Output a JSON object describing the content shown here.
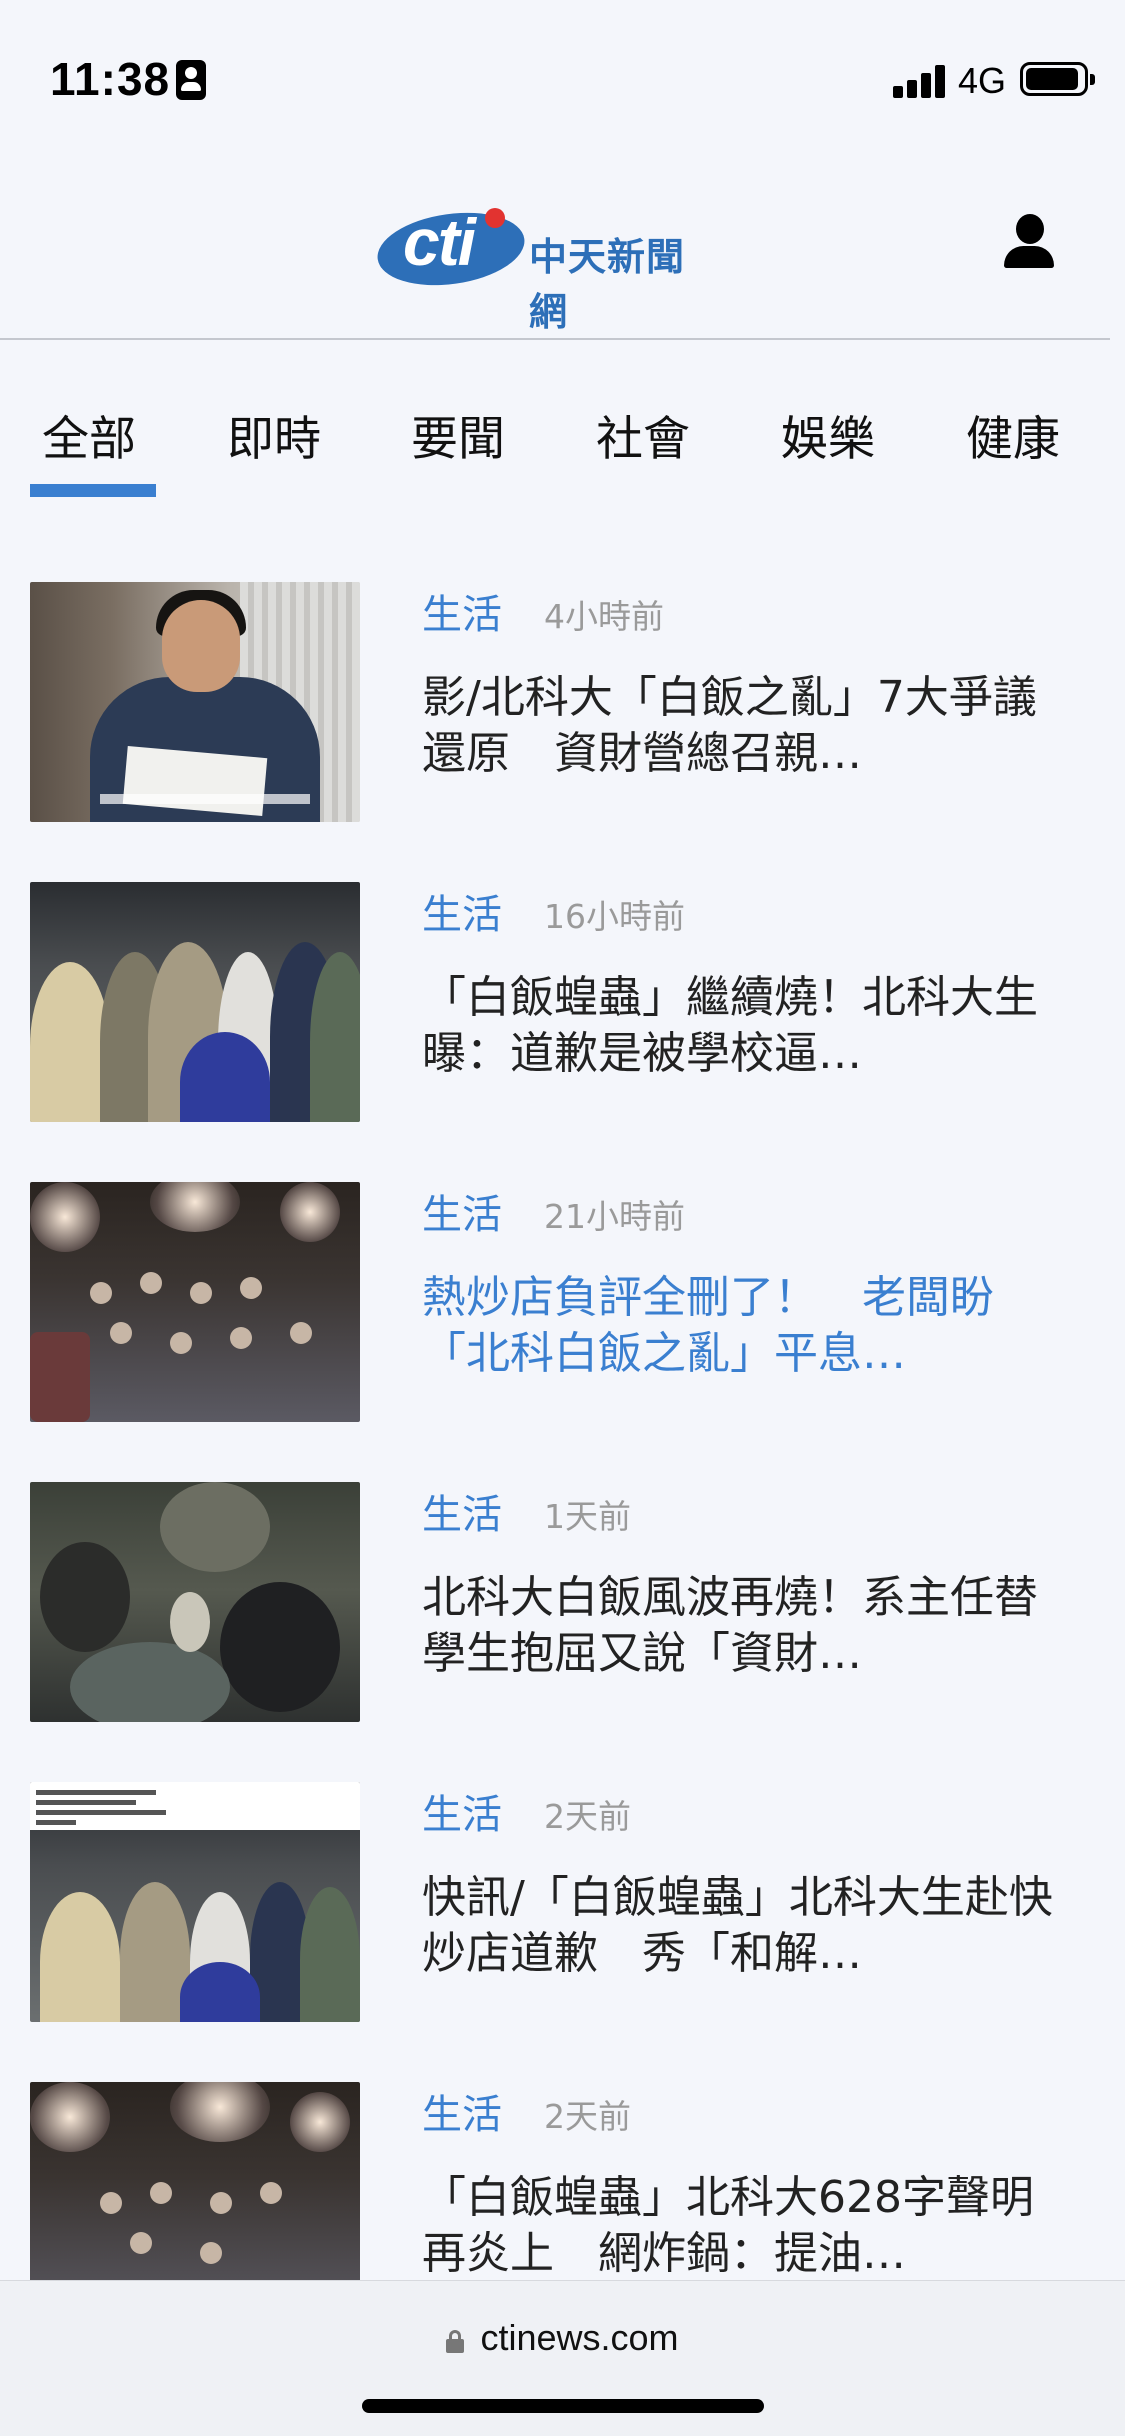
{
  "status_bar": {
    "time": "11:38",
    "network": "4G"
  },
  "header": {
    "logo_mark": "cti",
    "logo_text": "中天新聞網"
  },
  "tabs": [
    {
      "label": "全部",
      "selected": true
    },
    {
      "label": "即時"
    },
    {
      "label": "要聞"
    },
    {
      "label": "社會"
    },
    {
      "label": "娛樂"
    },
    {
      "label": "健康"
    }
  ],
  "news": [
    {
      "category": "生活",
      "time": "4小時前",
      "title": "影/北科大「白飯之亂」7大爭議還原　資財營總召親…",
      "visited": false
    },
    {
      "category": "生活",
      "time": "16小時前",
      "title": "「白飯蝗蟲」繼續燒！北科大生曝：道歉是被學校逼…",
      "visited": false
    },
    {
      "category": "生活",
      "time": "21小時前",
      "title": "熱炒店負評全刪了！　老闆盼「北科白飯之亂」平息…",
      "visited": true
    },
    {
      "category": "生活",
      "time": "1天前",
      "title": "北科大白飯風波再燒！系主任替學生抱屈又說「資財…",
      "visited": false
    },
    {
      "category": "生活",
      "time": "2天前",
      "title": "快訊/「白飯蝗蟲」北科大生赴快炒店道歉　秀「和解…",
      "visited": false
    },
    {
      "category": "生活",
      "time": "2天前",
      "title": "「白飯蝗蟲」北科大628字聲明再炎上　網炸鍋：提油…",
      "visited": false
    }
  ],
  "bottom_bar": {
    "url": "ctinews.com"
  },
  "colors": {
    "accent": "#3a7fd0",
    "logo_blue": "#2d6fb8",
    "logo_red": "#e23330",
    "background": "#f4f6fb"
  }
}
